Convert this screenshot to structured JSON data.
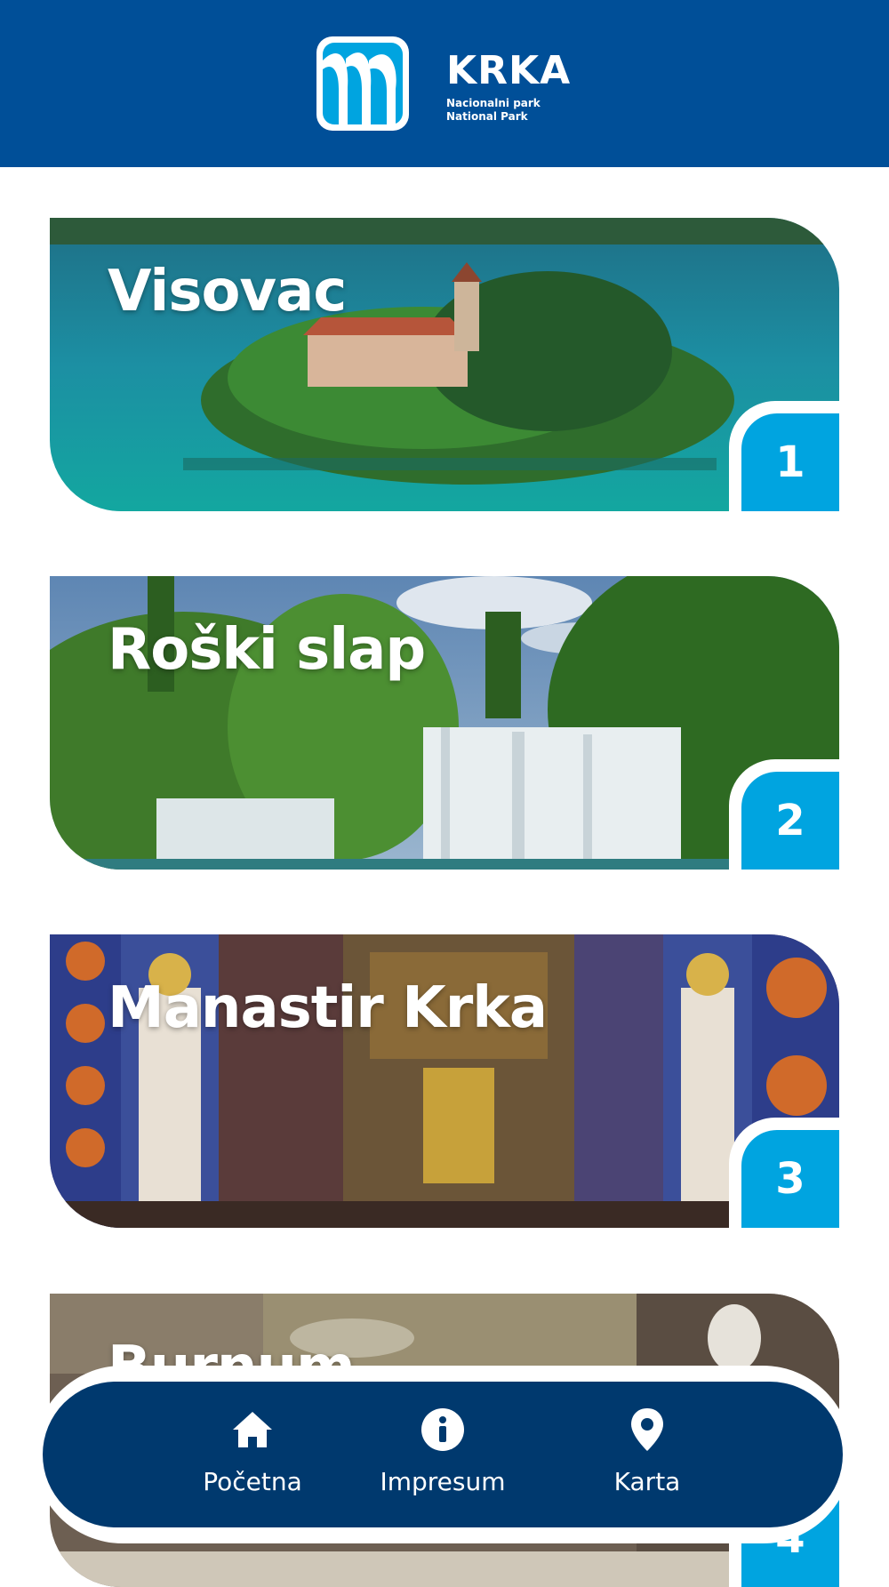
{
  "header": {
    "logo_title": "KRKA",
    "logo_sub_1": "Nacionalni park",
    "logo_sub_2": "National Park",
    "logo_icon": "waterfall-logo-icon"
  },
  "colors": {
    "header_bg": "#004f98",
    "nav_bg": "#00396e",
    "badge": "#00a4e0"
  },
  "cards": [
    {
      "title": "Visovac",
      "number": "1",
      "image": "island-monastery-lake-photo"
    },
    {
      "title": "Roški slap",
      "number": "2",
      "image": "waterfall-forest-photo"
    },
    {
      "title": "Manastir Krka",
      "number": "3",
      "image": "orthodox-church-frescoes-photo"
    },
    {
      "title": "Burnum",
      "number": "4",
      "image": "roman-ruins-museum-photo"
    }
  ],
  "nav": {
    "items": [
      {
        "label": "Početna",
        "icon": "home-icon"
      },
      {
        "label": "Impresum",
        "icon": "info-icon"
      },
      {
        "label": "Karta",
        "icon": "map-pin-icon"
      }
    ]
  }
}
